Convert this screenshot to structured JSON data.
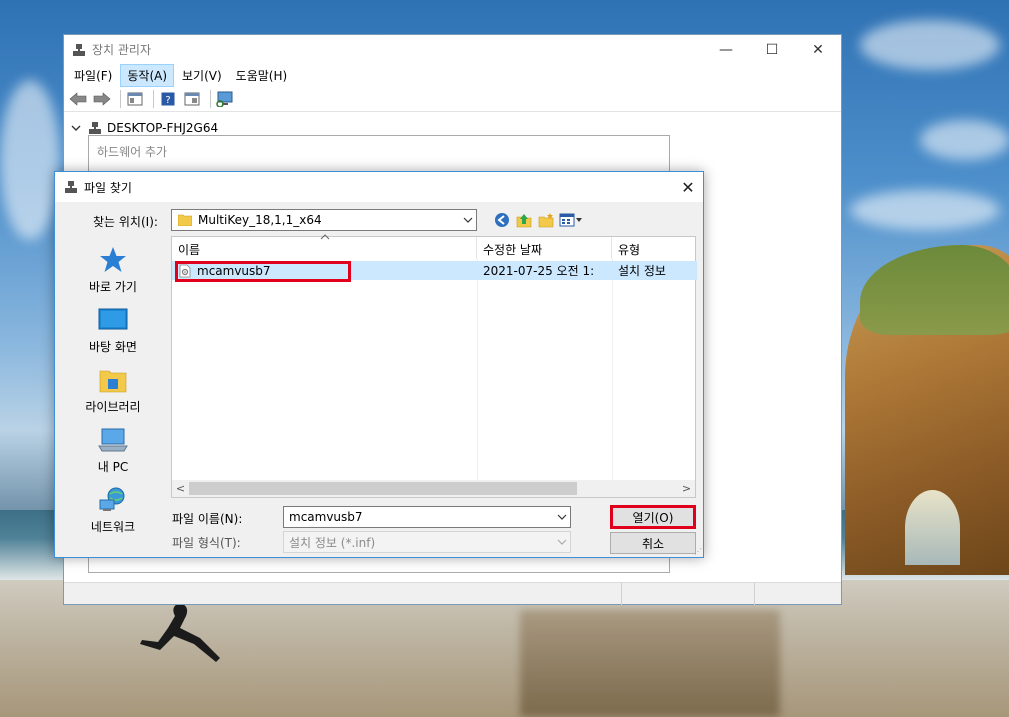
{
  "device_manager": {
    "title": "장치 관리자",
    "menu": [
      "파일(F)",
      "동작(A)",
      "보기(V)",
      "도움말(H)"
    ],
    "active_menu_index": 1,
    "tree_root": "DESKTOP-FHJ2G64",
    "window_controls": {
      "minimize": "—",
      "maximize": "☐",
      "close": "✕"
    }
  },
  "hardware_wizard": {
    "title": "하드웨어 추가"
  },
  "file_dialog": {
    "title": "파일 찾기",
    "close": "✕",
    "look_in_label": "찾는 위치(I):",
    "look_in_value": "MultiKey_18,1,1_x64",
    "places": [
      {
        "label": "바로 가기",
        "icon": "quick-access-star-icon"
      },
      {
        "label": "바탕 화면",
        "icon": "desktop-icon"
      },
      {
        "label": "라이브러리",
        "icon": "libraries-icon"
      },
      {
        "label": "내 PC",
        "icon": "this-pc-icon"
      },
      {
        "label": "네트워크",
        "icon": "network-icon"
      }
    ],
    "columns": [
      "이름",
      "수정한 날짜",
      "유형"
    ],
    "files": [
      {
        "name": "mcamvusb7",
        "date": "2021-07-25 오전 1:",
        "type": "설치 정보",
        "selected": true
      }
    ],
    "file_name_label": "파일 이름(N):",
    "file_name_value": "mcamvusb7",
    "file_type_label": "파일 형식(T):",
    "file_type_value": "설치 정보 (*.inf)",
    "open_button": "열기(O)",
    "cancel_button": "취소",
    "scroll_left": "<",
    "scroll_right": ">"
  },
  "colors": {
    "selection": "#cce8ff",
    "highlight_box": "#e0001b",
    "dialog_border": "#3c8fd8"
  }
}
